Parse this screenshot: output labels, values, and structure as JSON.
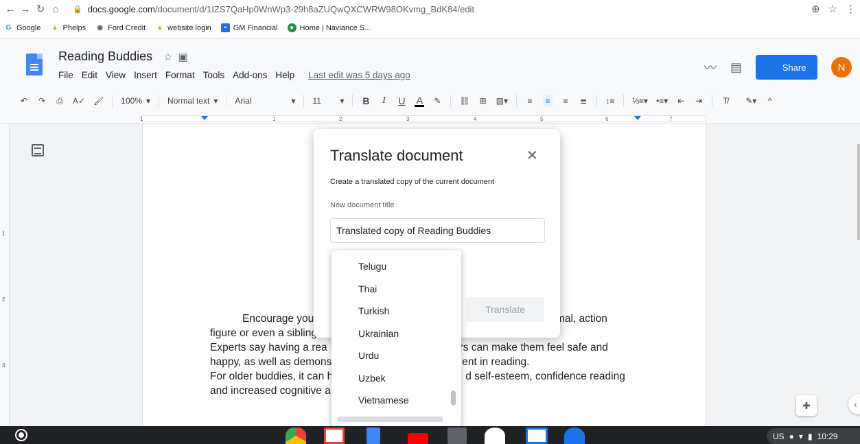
{
  "browser": {
    "url_domain": "docs.google.com",
    "url_path": "/document/d/1IZS7QaHp0WnWp3-29h8aZUQwQXCWRW98OKvmg_BdK84/edit",
    "bookmarks": [
      {
        "label": "Google",
        "icon": "google-icon",
        "color": "#4285f4"
      },
      {
        "label": "Phelps",
        "icon": "phelps-logo-icon",
        "color": "#f29900"
      },
      {
        "label": "Ford Credit",
        "icon": "globe-icon",
        "color": "#5f6368"
      },
      {
        "label": "website login",
        "icon": "phelps-logo-icon",
        "color": "#f29900"
      },
      {
        "label": "GM Financial",
        "icon": "gm-financial-icon",
        "color": "#1a73e8"
      },
      {
        "label": "Home | Naviance S...",
        "icon": "naviance-icon",
        "color": "#1e8e3e"
      }
    ]
  },
  "docs": {
    "title": "Reading Buddies",
    "menu": [
      "File",
      "Edit",
      "View",
      "Insert",
      "Format",
      "Tools",
      "Add-ons",
      "Help"
    ],
    "last_edit": "Last edit was 5 days ago",
    "share_label": "Share",
    "avatar_initial": "N",
    "avatar_color": "#e8710a"
  },
  "toolbar": {
    "zoom": "100%",
    "style": "Normal text",
    "font": "Arial",
    "font_size": "11",
    "bold": "B",
    "italic": "I",
    "underline": "U",
    "text_color": "A"
  },
  "ruler": {
    "numbers": [
      "1",
      "1",
      "2",
      "3",
      "4",
      "5",
      "6",
      "7"
    ],
    "vertical_numbers": [
      "1",
      "2",
      "3"
    ]
  },
  "document": {
    "lines": [
      "Encourage you",
      "animal, action",
      "figure or even a sibling",
      "Experts say having a rea",
      "rs can make them feel safe and",
      "happy, as well as demons",
      "ent in reading.",
      "For older buddies, it can h",
      "d self-esteem, confidence reading",
      "and increased cognitive a"
    ]
  },
  "modal": {
    "title": "Translate document",
    "description": "Create a translated copy of the current document",
    "field_label": "New document title",
    "field_value": "Translated copy of Reading Buddies",
    "translate_button": "Translate"
  },
  "languages": [
    "Telugu",
    "Thai",
    "Turkish",
    "Ukrainian",
    "Urdu",
    "Uzbek",
    "Vietnamese"
  ],
  "system": {
    "keyboard": "US",
    "time": "10:29",
    "shelf_apps": [
      "chrome",
      "gmail",
      "docs",
      "youtube",
      "files-manager",
      "play-store",
      "naviance",
      "files"
    ]
  },
  "colors": {
    "accent": "#1a73e8",
    "docs_blue": "#4285f4"
  }
}
